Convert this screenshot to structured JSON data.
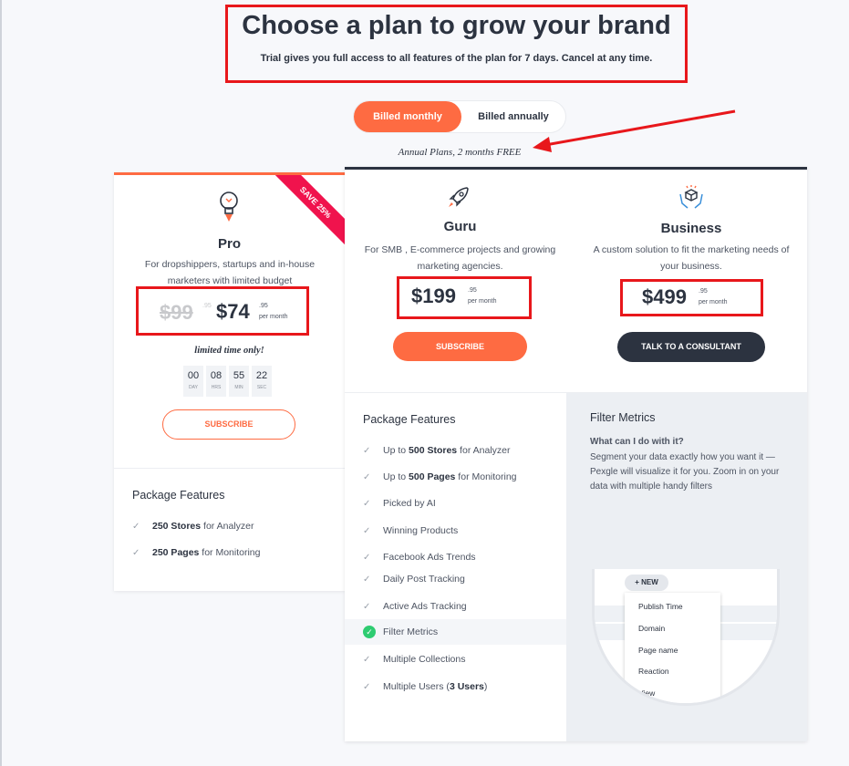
{
  "header": {
    "title": "Choose a plan to grow your brand",
    "subtitle": "Trial gives you full access to all features of the plan for 7 days. Cancel at any time."
  },
  "billing_toggle": {
    "monthly_label": "Billed monthly",
    "annual_label": "Billed annually",
    "selected": "monthly",
    "annual_note": "Annual Plans, 2 months FREE"
  },
  "plans": {
    "pro": {
      "ribbon": "SAVE 25%",
      "name": "Pro",
      "description": "For dropshippers, startups and in-house marketers with limited budget",
      "old_price": "$99",
      "old_cents": ".95",
      "price": "$74",
      "cents": ".95",
      "per": "per month",
      "limited": "limited time only!",
      "countdown": [
        {
          "value": "00",
          "unit": "DAY"
        },
        {
          "value": "08",
          "unit": "HRS"
        },
        {
          "value": "55",
          "unit": "MIN"
        },
        {
          "value": "22",
          "unit": "SEC"
        }
      ],
      "cta": "SUBSCRIBE",
      "features_title": "Package Features",
      "features": [
        {
          "bold": "250 Stores",
          "rest": " for Analyzer"
        },
        {
          "bold": "250 Pages",
          "rest": " for Monitoring"
        }
      ]
    },
    "guru": {
      "name": "Guru",
      "description": "For SMB , E-commerce projects and growing marketing agencies.",
      "price": "$199",
      "cents": ".95",
      "per": "per month",
      "cta": "SUBSCRIBE"
    },
    "business": {
      "name": "Business",
      "description": "A custom solution to fit the marketing needs of your business.",
      "price": "$499",
      "cents": ".95",
      "per": "per month",
      "cta": "TALK TO A CONSULTANT"
    }
  },
  "big_features": {
    "title": "Package Features",
    "items": [
      {
        "pre": "Up to ",
        "bold": "500 Stores",
        "post": " for Analyzer"
      },
      {
        "pre": "Up to ",
        "bold": "500 Pages",
        "post": " for Monitoring"
      },
      {
        "pre": "Picked by AI",
        "bold": "",
        "post": ""
      },
      {
        "pre": "Winning Products",
        "bold": "",
        "post": ""
      },
      {
        "pre": "Facebook Ads Trends",
        "bold": "",
        "post": ""
      },
      {
        "pre": "Daily Post Tracking",
        "bold": "",
        "post": ""
      },
      {
        "pre": "Active Ads Tracking",
        "bold": "",
        "post": ""
      },
      {
        "pre": "Filter Metrics",
        "bold": "",
        "post": ""
      },
      {
        "pre": "Multiple Collections",
        "bold": "",
        "post": ""
      },
      {
        "pre": "Multiple Users (",
        "bold": "3 Users",
        "post": ")"
      }
    ],
    "active_index": 7
  },
  "metrics_panel": {
    "title": "Filter Metrics",
    "question": "What can I do with it?",
    "text": "Segment your data exactly how you want it — Pexgle will visualize it for you. Zoom in on your data with multiple handy filters",
    "new_button": "+ NEW",
    "menu": [
      "Publish Time",
      "Domain",
      "Page name",
      "Reaction",
      "View"
    ]
  },
  "colors": {
    "accent": "#fe6b42",
    "dark": "#2c3340",
    "annotation_red": "#e8171b",
    "ribbon": "#f0134d",
    "check_green": "#2ecc71"
  },
  "icons": {
    "pro": "lightbulb-rocket-icon",
    "guru": "rocket-icon",
    "business": "hands-cube-icon",
    "check": "check-icon"
  }
}
